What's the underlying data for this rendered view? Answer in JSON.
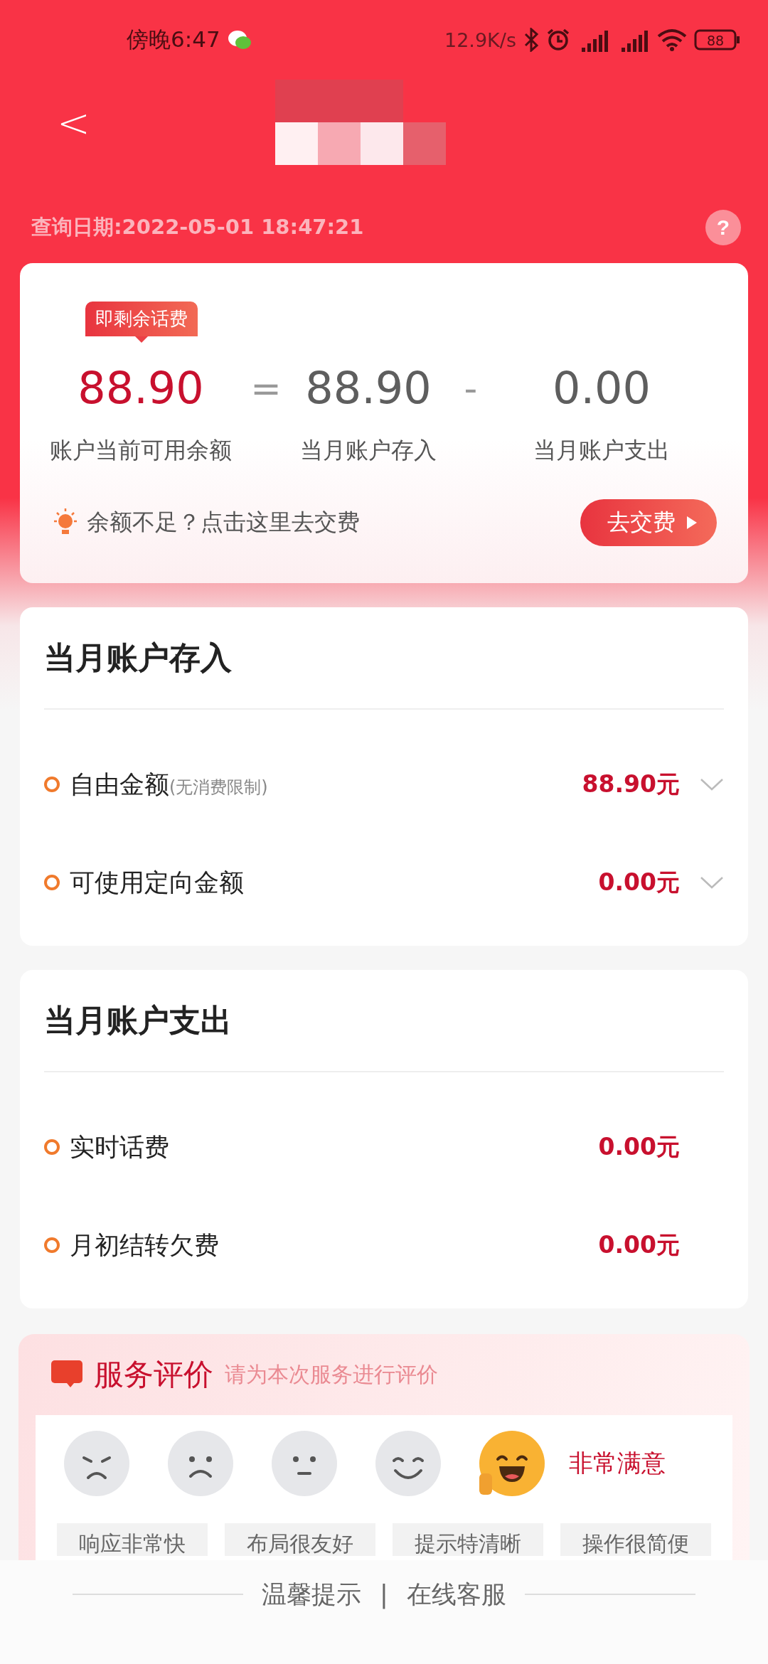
{
  "status_bar": {
    "time": "傍晚6:47",
    "speed": "12.9K/s",
    "battery": "88"
  },
  "header": {
    "back": "<"
  },
  "query_date": "查询日期:2022-05-01 18:47:21",
  "help": "?",
  "summary": {
    "badge": "即剩余话费",
    "items": [
      {
        "value": "88.90",
        "label": "账户当前可用余额",
        "kind": "main"
      },
      {
        "value": "88.90",
        "label": "当月账户存入",
        "kind": "plain"
      },
      {
        "value": "0.00",
        "label": "当月账户支出",
        "kind": "plain"
      }
    ],
    "operators": [
      "=",
      "-"
    ],
    "tip": "余额不足？点击这里去交费",
    "pay_button": "去交费"
  },
  "sections": [
    {
      "title": "当月账户存入",
      "rows": [
        {
          "label": "自由金额",
          "note": "(无消费限制)",
          "amount": "88.90元",
          "expandable": true
        },
        {
          "label": "可使用定向金额",
          "amount": "0.00元",
          "expandable": true
        }
      ]
    },
    {
      "title": "当月账户支出",
      "rows": [
        {
          "label": "实时话费",
          "amount": "0.00元",
          "expandable": false
        },
        {
          "label": "月初结转欠费",
          "amount": "0.00元",
          "expandable": false
        }
      ]
    }
  ],
  "rating": {
    "title": "服务评价",
    "subtitle": "请为本次服务进行评价",
    "faces": [
      {
        "kind": "angry",
        "selected": false
      },
      {
        "kind": "sad",
        "selected": false
      },
      {
        "kind": "neutral",
        "selected": false
      },
      {
        "kind": "smile",
        "selected": false
      },
      {
        "kind": "laugh",
        "selected": true
      }
    ],
    "selected_label": "非常满意",
    "tags": [
      "响应非常快",
      "布局很友好",
      "提示特清晰",
      "操作很简便"
    ]
  },
  "footer": {
    "links": [
      "温馨提示",
      "在线客服"
    ],
    "separator": "|"
  }
}
